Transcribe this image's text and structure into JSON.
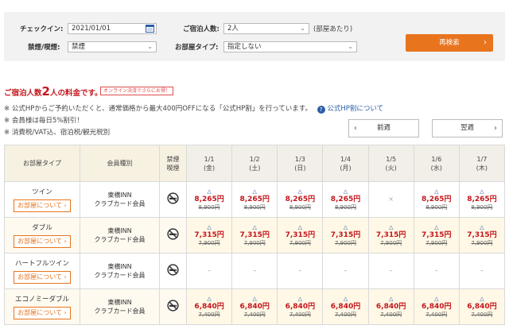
{
  "search": {
    "checkin_label": "チェックイン:",
    "checkin_value": "2021/01/01",
    "guests_label": "ご宿泊人数:",
    "guests_value": "2人",
    "guests_note": "(部屋あたり)",
    "smoking_label": "禁煙/喫煙:",
    "smoking_value": "禁煙",
    "roomtype_label": "お部屋タイプ:",
    "roomtype_value": "指定しない",
    "search_button": "再検索"
  },
  "heading": {
    "prefix": "ご宿泊人数",
    "count": "2",
    "suffix": "人の料金です。",
    "badge": "オンライン決済でさらにお得！"
  },
  "info": {
    "line1": "※ 公式HPからご予約いただくと、通常価格から最大400円OFFになる「公式HP割」を行っています。",
    "line1_link": "公式HP割について",
    "line2": "※ 会員様は毎日5%割引！",
    "line3": "※ 消費税/VAT込、宿泊税/観光税別"
  },
  "nav": {
    "prev": "前週",
    "next": "翌週"
  },
  "table": {
    "headers": {
      "room": "お部屋タイプ",
      "member": "会員種別",
      "smoke1": "禁煙",
      "smoke2": "喫煙"
    },
    "dates": [
      {
        "d": "1/1",
        "w": "(金)"
      },
      {
        "d": "1/2",
        "w": "(土)"
      },
      {
        "d": "1/3",
        "w": "(日)"
      },
      {
        "d": "1/4",
        "w": "(月)"
      },
      {
        "d": "1/5",
        "w": "(火)"
      },
      {
        "d": "1/6",
        "w": "(水)"
      },
      {
        "d": "1/7",
        "w": "(木)"
      }
    ],
    "room_button": "お部屋について",
    "member_line1": "東横INN",
    "member_line2": "クラブカード会員",
    "rows": [
      {
        "name": "ツイン",
        "price": "8,265円",
        "orig": "8,900円",
        "avail": [
          "p",
          "p",
          "p",
          "p",
          "x",
          "p",
          "p"
        ]
      },
      {
        "name": "ダブル",
        "price": "7,315円",
        "orig": "7,900円",
        "avail": [
          "p",
          "p",
          "p",
          "p",
          "p",
          "p",
          "p"
        ]
      },
      {
        "name": "ハートフルツイン",
        "price": "",
        "orig": "",
        "avail": [
          "-",
          "-",
          "-",
          "-",
          "-",
          "-",
          "-"
        ]
      },
      {
        "name": "エコノミーダブル",
        "price": "6,840円",
        "orig": "7,400円",
        "avail": [
          "p",
          "p",
          "p",
          "p",
          "p",
          "p",
          "p"
        ]
      }
    ]
  },
  "icons": {
    "calendar": "calendar-icon",
    "chevron": "chevron-down-icon",
    "no_smoking": "no-smoking-icon",
    "help": "help-icon"
  },
  "colors": {
    "accent": "#e8741e",
    "price": "#c4161c",
    "link": "#2a5fa8"
  }
}
